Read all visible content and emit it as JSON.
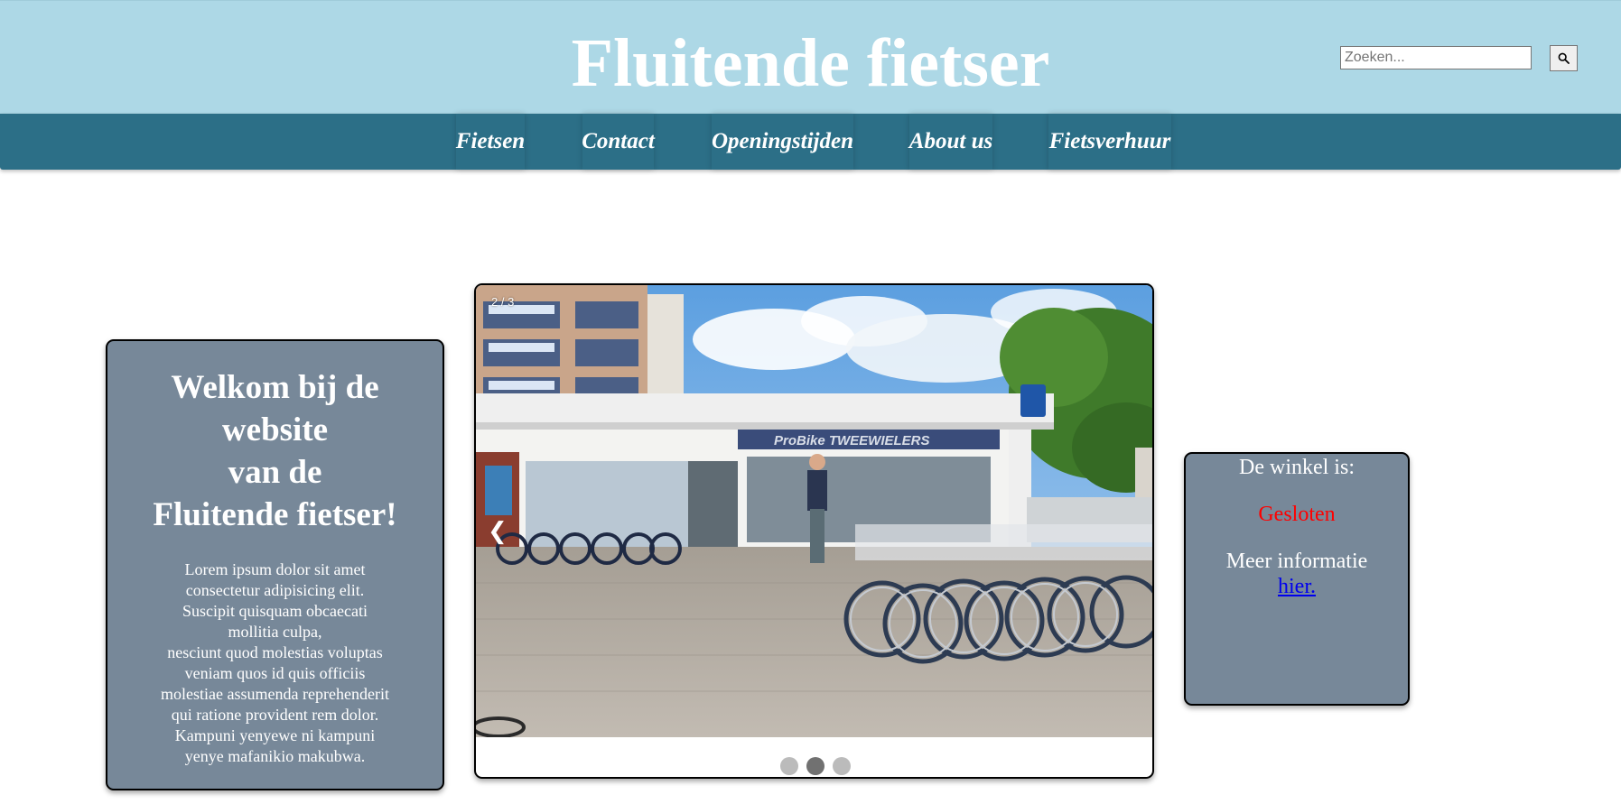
{
  "header": {
    "title": "Fluitende fietser",
    "search_placeholder": "Zoeken...",
    "search_icon": "search-icon"
  },
  "nav": {
    "items": [
      {
        "label": "Fietsen"
      },
      {
        "label": "Contact"
      },
      {
        "label": "Openingstijden"
      },
      {
        "label": "About us"
      },
      {
        "label": "Fietsverhuur"
      }
    ]
  },
  "welcome": {
    "heading": "Welkom bij de\nwebsite\nvan de\nFluitende fietser!",
    "body": "Lorem ipsum dolor sit amet\nconsectetur adipisicing elit.\nSuscipit quisquam obcaecati\nmollitia culpa,\nnesciunt quod molestias voluptas\nveniam quos id quis officiis\nmolestiae assumenda reprehenderit\nqui ratione provident rem dolor.\nKampuni yenyewe ni kampuni\nyenye mafanikio makubwa."
  },
  "carousel": {
    "counter": "2 / 3",
    "prev_icon": "chevron-left-icon",
    "prev_glyph": "❮",
    "total_slides": 3,
    "active_slide": 2,
    "shop_sign": "ProBike  TWEEWIELERS"
  },
  "status": {
    "label": "De winkel is:",
    "value": "Gesloten",
    "more": "Meer informatie",
    "link": "hier.",
    "value_color": "#ff0000"
  },
  "colors": {
    "header_bg": "#add8e6",
    "nav_bg": "#2c6f87",
    "card_bg": "#778899",
    "link": "#0000ee"
  }
}
